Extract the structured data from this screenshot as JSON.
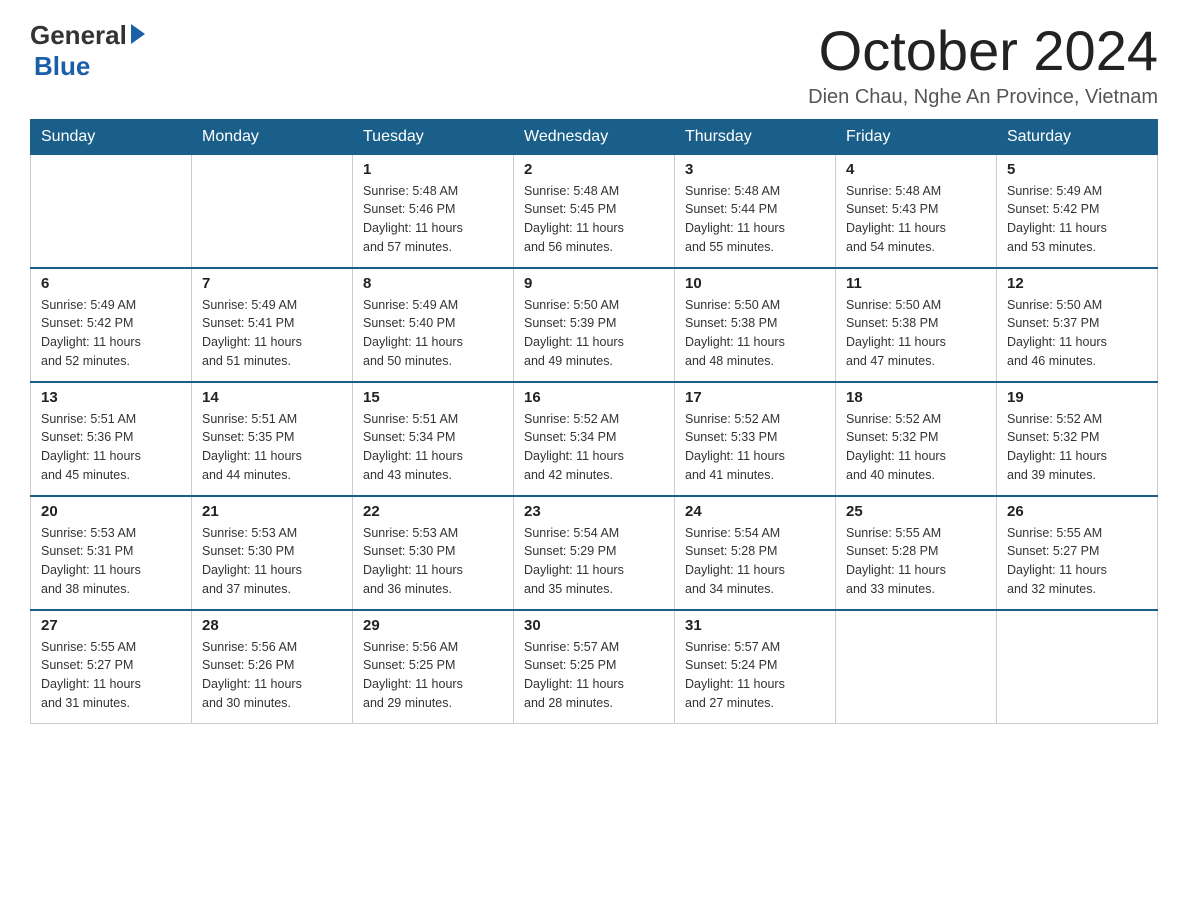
{
  "header": {
    "logo_general": "General",
    "logo_blue": "Blue",
    "month_title": "October 2024",
    "location": "Dien Chau, Nghe An Province, Vietnam"
  },
  "days_of_week": [
    "Sunday",
    "Monday",
    "Tuesday",
    "Wednesday",
    "Thursday",
    "Friday",
    "Saturday"
  ],
  "weeks": [
    [
      {
        "day": "",
        "info": ""
      },
      {
        "day": "",
        "info": ""
      },
      {
        "day": "1",
        "info": "Sunrise: 5:48 AM\nSunset: 5:46 PM\nDaylight: 11 hours\nand 57 minutes."
      },
      {
        "day": "2",
        "info": "Sunrise: 5:48 AM\nSunset: 5:45 PM\nDaylight: 11 hours\nand 56 minutes."
      },
      {
        "day": "3",
        "info": "Sunrise: 5:48 AM\nSunset: 5:44 PM\nDaylight: 11 hours\nand 55 minutes."
      },
      {
        "day": "4",
        "info": "Sunrise: 5:48 AM\nSunset: 5:43 PM\nDaylight: 11 hours\nand 54 minutes."
      },
      {
        "day": "5",
        "info": "Sunrise: 5:49 AM\nSunset: 5:42 PM\nDaylight: 11 hours\nand 53 minutes."
      }
    ],
    [
      {
        "day": "6",
        "info": "Sunrise: 5:49 AM\nSunset: 5:42 PM\nDaylight: 11 hours\nand 52 minutes."
      },
      {
        "day": "7",
        "info": "Sunrise: 5:49 AM\nSunset: 5:41 PM\nDaylight: 11 hours\nand 51 minutes."
      },
      {
        "day": "8",
        "info": "Sunrise: 5:49 AM\nSunset: 5:40 PM\nDaylight: 11 hours\nand 50 minutes."
      },
      {
        "day": "9",
        "info": "Sunrise: 5:50 AM\nSunset: 5:39 PM\nDaylight: 11 hours\nand 49 minutes."
      },
      {
        "day": "10",
        "info": "Sunrise: 5:50 AM\nSunset: 5:38 PM\nDaylight: 11 hours\nand 48 minutes."
      },
      {
        "day": "11",
        "info": "Sunrise: 5:50 AM\nSunset: 5:38 PM\nDaylight: 11 hours\nand 47 minutes."
      },
      {
        "day": "12",
        "info": "Sunrise: 5:50 AM\nSunset: 5:37 PM\nDaylight: 11 hours\nand 46 minutes."
      }
    ],
    [
      {
        "day": "13",
        "info": "Sunrise: 5:51 AM\nSunset: 5:36 PM\nDaylight: 11 hours\nand 45 minutes."
      },
      {
        "day": "14",
        "info": "Sunrise: 5:51 AM\nSunset: 5:35 PM\nDaylight: 11 hours\nand 44 minutes."
      },
      {
        "day": "15",
        "info": "Sunrise: 5:51 AM\nSunset: 5:34 PM\nDaylight: 11 hours\nand 43 minutes."
      },
      {
        "day": "16",
        "info": "Sunrise: 5:52 AM\nSunset: 5:34 PM\nDaylight: 11 hours\nand 42 minutes."
      },
      {
        "day": "17",
        "info": "Sunrise: 5:52 AM\nSunset: 5:33 PM\nDaylight: 11 hours\nand 41 minutes."
      },
      {
        "day": "18",
        "info": "Sunrise: 5:52 AM\nSunset: 5:32 PM\nDaylight: 11 hours\nand 40 minutes."
      },
      {
        "day": "19",
        "info": "Sunrise: 5:52 AM\nSunset: 5:32 PM\nDaylight: 11 hours\nand 39 minutes."
      }
    ],
    [
      {
        "day": "20",
        "info": "Sunrise: 5:53 AM\nSunset: 5:31 PM\nDaylight: 11 hours\nand 38 minutes."
      },
      {
        "day": "21",
        "info": "Sunrise: 5:53 AM\nSunset: 5:30 PM\nDaylight: 11 hours\nand 37 minutes."
      },
      {
        "day": "22",
        "info": "Sunrise: 5:53 AM\nSunset: 5:30 PM\nDaylight: 11 hours\nand 36 minutes."
      },
      {
        "day": "23",
        "info": "Sunrise: 5:54 AM\nSunset: 5:29 PM\nDaylight: 11 hours\nand 35 minutes."
      },
      {
        "day": "24",
        "info": "Sunrise: 5:54 AM\nSunset: 5:28 PM\nDaylight: 11 hours\nand 34 minutes."
      },
      {
        "day": "25",
        "info": "Sunrise: 5:55 AM\nSunset: 5:28 PM\nDaylight: 11 hours\nand 33 minutes."
      },
      {
        "day": "26",
        "info": "Sunrise: 5:55 AM\nSunset: 5:27 PM\nDaylight: 11 hours\nand 32 minutes."
      }
    ],
    [
      {
        "day": "27",
        "info": "Sunrise: 5:55 AM\nSunset: 5:27 PM\nDaylight: 11 hours\nand 31 minutes."
      },
      {
        "day": "28",
        "info": "Sunrise: 5:56 AM\nSunset: 5:26 PM\nDaylight: 11 hours\nand 30 minutes."
      },
      {
        "day": "29",
        "info": "Sunrise: 5:56 AM\nSunset: 5:25 PM\nDaylight: 11 hours\nand 29 minutes."
      },
      {
        "day": "30",
        "info": "Sunrise: 5:57 AM\nSunset: 5:25 PM\nDaylight: 11 hours\nand 28 minutes."
      },
      {
        "day": "31",
        "info": "Sunrise: 5:57 AM\nSunset: 5:24 PM\nDaylight: 11 hours\nand 27 minutes."
      },
      {
        "day": "",
        "info": ""
      },
      {
        "day": "",
        "info": ""
      }
    ]
  ]
}
